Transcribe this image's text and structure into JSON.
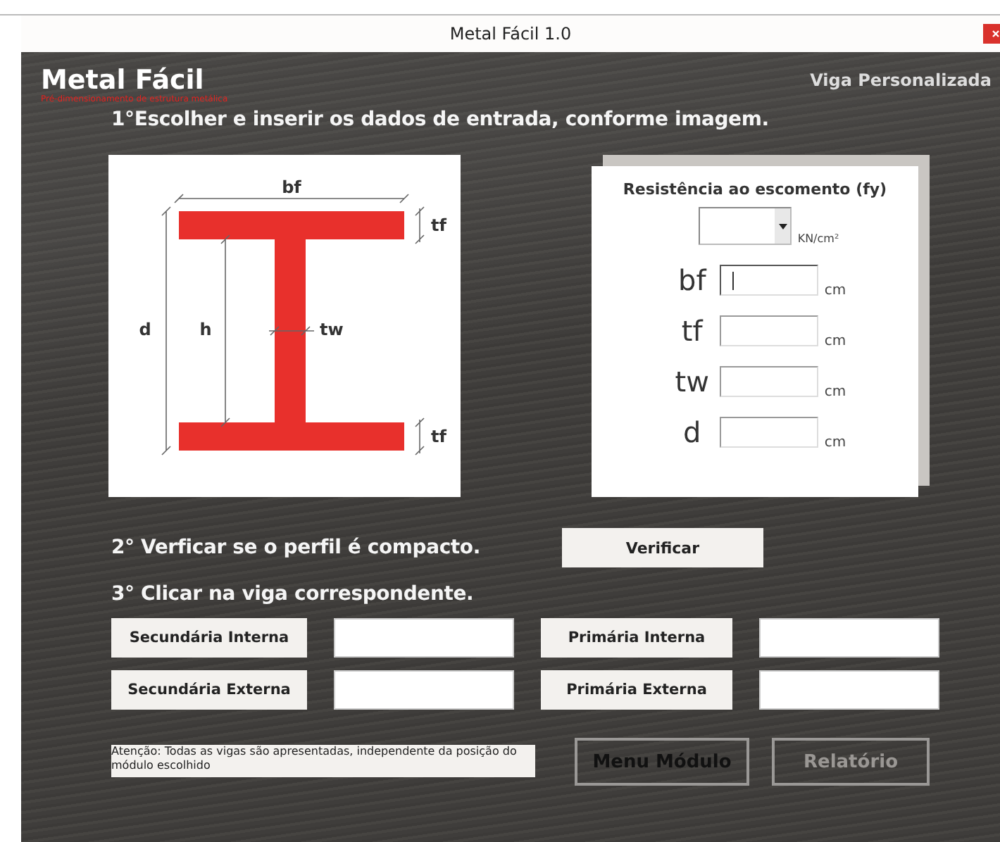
{
  "window": {
    "title": "Metal Fácil 1.0"
  },
  "header": {
    "logo": "Metal Fácil",
    "tagline": "Pré-dimensionamento de estrutura metálica",
    "screen_title": "Viga Personalizada"
  },
  "step_1": "1°Escolher e inserir os dados de entrada, conforme imagem.",
  "diagram": {
    "labels": [
      {
        "kind": "bf",
        "text": "bf"
      },
      {
        "kind": "tf_top",
        "text": "tf"
      },
      {
        "kind": "d",
        "text": "d"
      },
      {
        "kind": "h",
        "text": "h"
      },
      {
        "kind": "tw",
        "text": "tw"
      },
      {
        "kind": "tf_bottom",
        "text": "tf"
      }
    ]
  },
  "inputs": {
    "title": "Resistência ao escomento (fy)",
    "fy_unit": "KN/cm²",
    "fields": [
      {
        "label": "bf",
        "unit": "cm",
        "focused": true
      },
      {
        "label": "tf",
        "unit": "cm",
        "focused": false
      },
      {
        "label": "tw",
        "unit": "cm",
        "focused": false
      },
      {
        "label": "d",
        "unit": "cm",
        "focused": false
      }
    ]
  },
  "step_2": "2° Verficar se o perfil é compacto.",
  "verify_button": "Verificar",
  "step_3": "3° Clicar na viga correspondente.",
  "beams": [
    {
      "label": "Secundária Interna"
    },
    {
      "label": "Primária Interna"
    },
    {
      "label": "Secundária Externa"
    },
    {
      "label": "Primária Externa"
    }
  ],
  "note": "Atenção: Todas as vigas são apresentadas, independente da posição do módulo escolhido",
  "footer_buttons": [
    {
      "label": "Menu Módulo",
      "disabled": false
    },
    {
      "label": "Relatório",
      "disabled": true
    }
  ]
}
